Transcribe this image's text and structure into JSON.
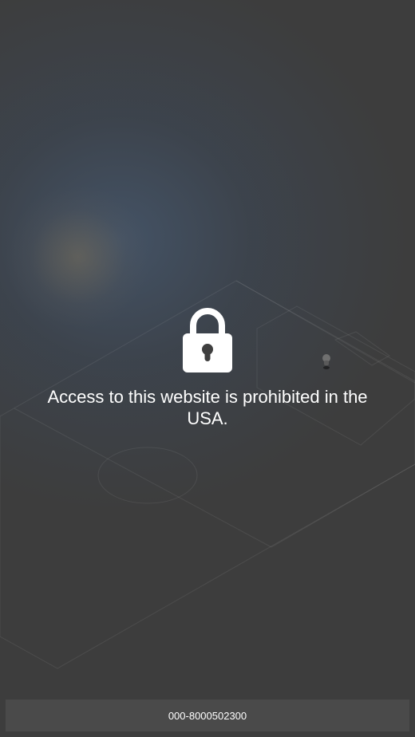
{
  "message": {
    "text": "Access to this website is prohibited in the USA."
  },
  "footer": {
    "text": "000-8000502300"
  },
  "icons": {
    "lock": "lock-icon"
  },
  "colors": {
    "background": "#3d3d3d",
    "text": "#ffffff",
    "footer_bar": "#4a4a4a"
  }
}
